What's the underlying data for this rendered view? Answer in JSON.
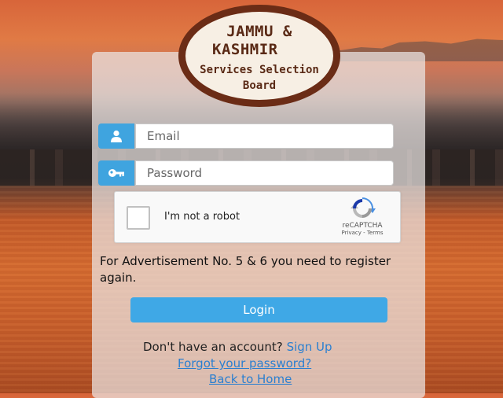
{
  "logo": {
    "line1": "JAMMU &",
    "line2": "KASHMIR",
    "line3": "Services Selection",
    "line4": "Board"
  },
  "form": {
    "email_placeholder": "Email",
    "password_placeholder": "Password",
    "email_icon": "user-icon",
    "password_icon": "key-icon"
  },
  "captcha": {
    "label": "I'm not a robot",
    "brand": "reCAPTCHA",
    "links": "Privacy - Terms"
  },
  "notice": "For Advertisement No. 5 & 6 you need to register again.",
  "login_label": "Login",
  "signup": {
    "prompt": "Don't have an account?",
    "link": "Sign Up"
  },
  "forgot_label": "Forgot your password?",
  "back_label": "Back to Home",
  "colors": {
    "accent": "#3fa4df",
    "logo_border": "#6b2c16",
    "link": "#2b7fd0"
  }
}
